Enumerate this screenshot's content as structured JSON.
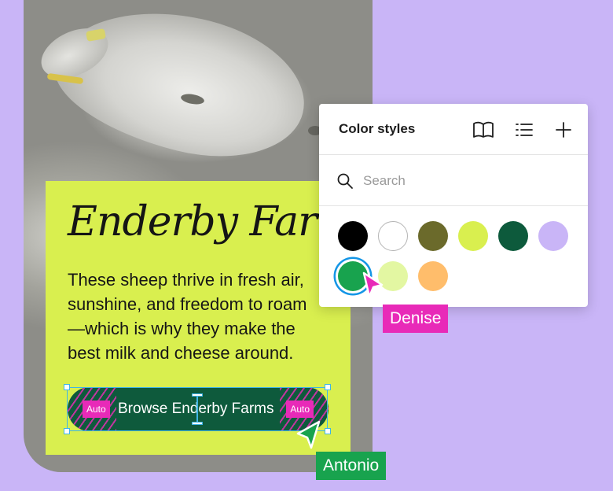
{
  "hero": {
    "title": "Enderby Farms",
    "body_lines": [
      "These sheep thrive in fresh air,",
      "sunshine, and freedom to roam",
      "—which is why they make the",
      "best milk and cheese around."
    ],
    "cta_label": "Browse Enderby Farms",
    "auto_left": "Auto",
    "auto_right": "Auto"
  },
  "color_styles": {
    "title": "Color styles",
    "icons": [
      "book-icon",
      "list-view-icon",
      "plus-icon"
    ],
    "search_placeholder": "Search",
    "selected_index": 6,
    "swatches": [
      "#000000",
      "#ffffff",
      "#6b6a2b",
      "#d9ef4f",
      "#0d5a3c",
      "#c9b5f7",
      "#18a34e",
      "#e3f7a2",
      "#ffbd6b"
    ]
  },
  "collaborators": [
    {
      "name": "Denise",
      "color": "#e82ab8"
    },
    {
      "name": "Antonio",
      "color": "#18a34e"
    }
  ],
  "colors": {
    "background": "#c9b5f7",
    "panel": "#d9ef4f",
    "button": "#0e5a3c",
    "selection": "#3eb5e6"
  }
}
